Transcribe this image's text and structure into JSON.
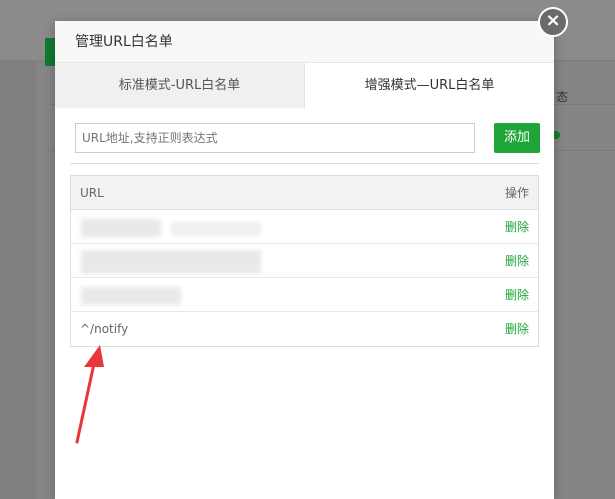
{
  "background": {
    "status_label": "态"
  },
  "modal": {
    "title": "管理URL白名单",
    "close_symbol": "×",
    "tabs": [
      {
        "label": "标准模式-URL白名单",
        "active": false
      },
      {
        "label": "增强模式—URL白名单",
        "active": true
      }
    ],
    "input_placeholder": "URL地址,支持正则表达式",
    "add_label": "添加",
    "table": {
      "headers": {
        "url": "URL",
        "action": "操作"
      },
      "rows": [
        {
          "url": "",
          "action": "删除",
          "obscured": true
        },
        {
          "url": "",
          "action": "删除",
          "obscured": true
        },
        {
          "url": "",
          "action": "删除",
          "obscured": true
        },
        {
          "url": "^/notify",
          "action": "删除",
          "obscured": false
        }
      ]
    }
  },
  "colors": {
    "accent": "#20a53a",
    "annotation_arrow": "#e8363a"
  }
}
